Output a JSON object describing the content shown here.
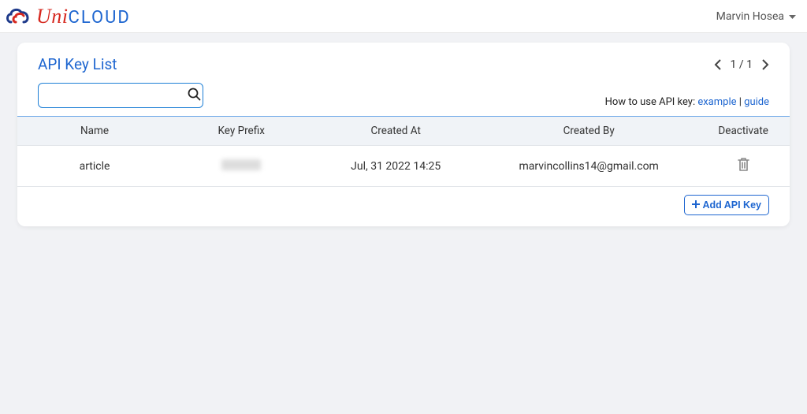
{
  "brand": {
    "uni": "Uni",
    "cloud": "CLOUD"
  },
  "user": {
    "name": "Marvin Hosea"
  },
  "page": {
    "title": "API Key List"
  },
  "pagination": {
    "current": "1",
    "sep": "/",
    "total": "1"
  },
  "search": {
    "placeholder": ""
  },
  "help": {
    "prefix": "How to use API key: ",
    "example_label": "example",
    "sep": " | ",
    "guide_label": "guide"
  },
  "columns": {
    "name": "Name",
    "prefix": "Key Prefix",
    "created_at": "Created At",
    "created_by": "Created By",
    "deactivate": "Deactivate"
  },
  "rows": [
    {
      "name": "article",
      "prefix_obscured": true,
      "created_at": "Jul, 31 2022 14:25",
      "created_by": "marvincollins14@gmail.com"
    }
  ],
  "buttons": {
    "add_api_key": "Add API Key"
  }
}
